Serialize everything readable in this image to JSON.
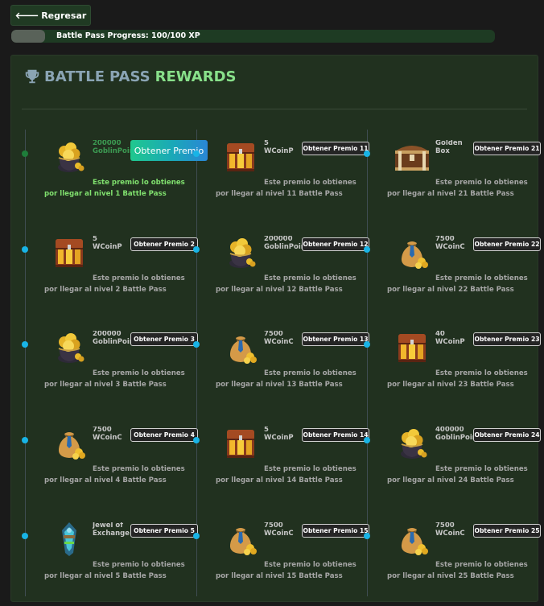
{
  "back_button": {
    "arrow": "🡐",
    "label": "Regresar"
  },
  "progress": {
    "label": "Battle Pass Progress: 100/100 XP",
    "current": 100,
    "max": 100,
    "bar_fill_fraction": 0.07
  },
  "header": {
    "title_parts": [
      "BATTLE",
      "PASS",
      "REWARDS"
    ],
    "icon": "trophy-icon"
  },
  "colors": {
    "accent_green": "#88e08a",
    "title_grey": "#8aa4b4",
    "timeline_dot": "#18b4e6",
    "panel_bg": "#21311f"
  },
  "rewards": [
    {
      "level": 1,
      "name_lines": [
        "200000",
        "GoblinPoint"
      ],
      "icon": "goblin-coin-icon",
      "button": "Obtener Premio",
      "desc_line1": "Este premio lo obtienes",
      "desc_line2": "por llegar al nivel 1 Battle Pass",
      "claimable": true
    },
    {
      "level": 2,
      "name_lines": [
        "5",
        "WCoinP"
      ],
      "icon": "treasure-chest-icon",
      "button": "Obtener Premio 2",
      "desc_line1": "Este premio lo obtienes",
      "desc_line2": "por llegar al nivel 2 Battle Pass"
    },
    {
      "level": 3,
      "name_lines": [
        "200000",
        "GoblinPoint"
      ],
      "icon": "goblin-coin-icon",
      "button": "Obtener Premio 3",
      "desc_line1": "Este premio lo obtienes",
      "desc_line2": "por llegar al nivel 3 Battle Pass"
    },
    {
      "level": 4,
      "name_lines": [
        "7500",
        "WCoinC"
      ],
      "icon": "coin-sack-icon",
      "button": "Obtener Premio 4",
      "desc_line1": "Este premio lo obtienes",
      "desc_line2": "por llegar al nivel 4 Battle Pass"
    },
    {
      "level": 5,
      "name_lines": [
        "Jewel of",
        "Exchange"
      ],
      "icon": "jewel-icon",
      "button": "Obtener Premio 5",
      "desc_line1": "Este premio lo obtienes",
      "desc_line2": "por llegar al nivel 5 Battle Pass"
    },
    {
      "level": 11,
      "name_lines": [
        "5",
        "WCoinP"
      ],
      "icon": "treasure-chest-icon",
      "button": "Obtener Premio 11",
      "desc_line1": "Este premio lo obtienes",
      "desc_line2": "por llegar al nivel 11 Battle Pass"
    },
    {
      "level": 12,
      "name_lines": [
        "200000",
        "GoblinPoint"
      ],
      "icon": "goblin-coin-icon",
      "button": "Obtener Premio 12",
      "desc_line1": "Este premio lo obtienes",
      "desc_line2": "por llegar al nivel 12 Battle Pass"
    },
    {
      "level": 13,
      "name_lines": [
        "7500",
        "WCoinC"
      ],
      "icon": "coin-sack-icon",
      "button": "Obtener Premio 13",
      "desc_line1": "Este premio lo obtienes",
      "desc_line2": "por llegar al nivel 13 Battle Pass"
    },
    {
      "level": 14,
      "name_lines": [
        "5",
        "WCoinP"
      ],
      "icon": "treasure-chest-icon",
      "button": "Obtener Premio 14",
      "desc_line1": "Este premio lo obtienes",
      "desc_line2": "por llegar al nivel 14 Battle Pass"
    },
    {
      "level": 15,
      "name_lines": [
        "7500",
        "WCoinC"
      ],
      "icon": "coin-sack-icon",
      "button": "Obtener Premio 15",
      "desc_line1": "Este premio lo obtienes",
      "desc_line2": "por llegar al nivel 15 Battle Pass"
    },
    {
      "level": 21,
      "name_lines": [
        "Golden",
        "Box"
      ],
      "icon": "golden-box-icon",
      "button": "Obtener Premio 21",
      "desc_line1": "Este premio lo obtienes",
      "desc_line2": "por llegar al nivel 21 Battle Pass"
    },
    {
      "level": 22,
      "name_lines": [
        "7500",
        "WCoinC"
      ],
      "icon": "coin-sack-icon",
      "button": "Obtener Premio 22",
      "desc_line1": "Este premio lo obtienes",
      "desc_line2": "por llegar al nivel 22 Battle Pass"
    },
    {
      "level": 23,
      "name_lines": [
        "40",
        "WCoinP"
      ],
      "icon": "treasure-chest-icon",
      "button": "Obtener Premio 23",
      "desc_line1": "Este premio lo obtienes",
      "desc_line2": "por llegar al nivel 23 Battle Pass"
    },
    {
      "level": 24,
      "name_lines": [
        "400000",
        "GoblinPoint"
      ],
      "icon": "goblin-coin-icon",
      "button": "Obtener Premio 24",
      "desc_line1": "Este premio lo obtienes",
      "desc_line2": "por llegar al nivel 24 Battle Pass"
    },
    {
      "level": 25,
      "name_lines": [
        "7500",
        "WCoinC"
      ],
      "icon": "coin-sack-icon",
      "button": "Obtener Premio 25",
      "desc_line1": "Este premio lo obtienes",
      "desc_line2": "por llegar al nivel 25 Battle Pass"
    }
  ]
}
